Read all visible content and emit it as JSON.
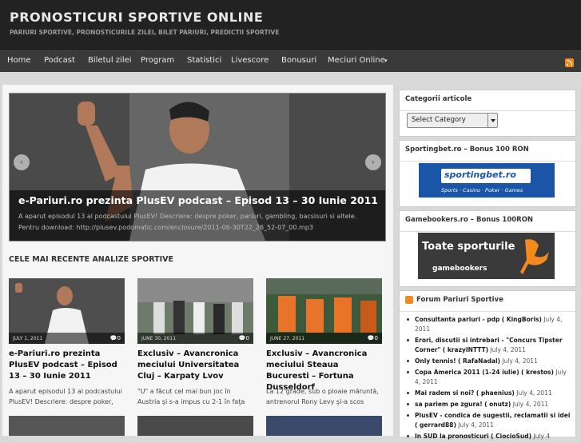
{
  "site": {
    "title": "PRONOSTICURI SPORTIVE ONLINE",
    "description": "PARIURI SPORTIVE, PRONOSTICURILE ZILEI, BILET PARIURI, PREDICTII SPORTIVE"
  },
  "nav": {
    "items": [
      "Home",
      "Podcast",
      "Biletul zilei",
      "Program",
      "Statistici",
      "Livescore",
      "Bonusuri",
      "Meciuri Online"
    ],
    "dropdown_icon": "caret-down-icon",
    "rss_icon": "rss-icon"
  },
  "slider": {
    "title": "e-Pariuri.ro prezinta PlusEV podcast – Episod 13 – 30 Iunie 2011",
    "excerpt": "A aparut episodul 13 al podcastului PlusEV! Descriere: despre poker, pariuri, gambling, bacsisuri si altele. Pentru download: http://plusev.podomatic.com/enclosure/2011-06-30T22_26_52-07_00.mp3",
    "prev_icon": "chevron-left-icon",
    "next_icon": "chevron-right-icon"
  },
  "recent": {
    "heading": "CELE MAI RECENTE ANALIZE SPORTIVE",
    "posts": [
      {
        "date": "JULY 1, 2011",
        "comments": "0",
        "title": "e-Pariuri.ro prezinta PlusEV podcast – Episod 13 – 30 Iunie 2011",
        "excerpt": "A aparut episodul 13 al podcastului PlusEV! Descriere: despre poker,"
      },
      {
        "date": "JUNE 30, 2011",
        "comments": "0",
        "title": "Exclusiv – Avancronica meciului Universitatea Cluj – Karpaty Lvov",
        "excerpt": "\"U\" a făcut cel mai bun joc în Austria şi s-a impus cu 2-1 în faţa"
      },
      {
        "date": "JUNE 27, 2011",
        "comments": "0",
        "title": "Exclusiv – Avancronica meciului Steaua Bucuresti – Fortuna Dusseldorf",
        "excerpt": "La 12 grade, sub o ploaie măruntă, antrenorul Rony Levy şi-a scos"
      }
    ]
  },
  "sidebar": {
    "categories": {
      "title": "Categorii articole",
      "select_value": "Select Category"
    },
    "sportingbet": {
      "title": "Sportingbet.ro – Bonus 100 RON",
      "banner_brand": "sportingbet.ro",
      "banner_tagline": "Sports · Casino · Poker · Games"
    },
    "gamebookers": {
      "title": "Gamebookers.ro – Bonus 100RON",
      "banner_text": "Toate sporturile",
      "banner_brand": "gamebookers"
    },
    "forum": {
      "title": "Forum Pariuri Sportive",
      "items": [
        {
          "link": "Consultanta pariuri - pdp",
          "author": "( KingBoris)",
          "date": "July 4, 2011"
        },
        {
          "link": "Erori, discutii si intrebari - \"Concurs Tipster Corner\"",
          "author": "( krazyINTTT)",
          "date": "July 4, 2011"
        },
        {
          "link": "Only tennis!",
          "author": "( RafaNadal)",
          "date": "July 4, 2011"
        },
        {
          "link": "Copa America 2011 (1-24 iulie)",
          "author": "( krestos)",
          "date": "July 4, 2011"
        },
        {
          "link": "Mai radem si noi?",
          "author": "( phaenius)",
          "date": "July 4, 2011"
        },
        {
          "link": "sa pariem pe zgura!",
          "author": "( onutz)",
          "date": "July 4, 2011"
        },
        {
          "link": "PlusEV - condica de sugestii, reclamatii si idei",
          "author": "( gerrard88)",
          "date": "July 4, 2011"
        },
        {
          "link": "In SUD la pronosticuri",
          "author": "( CiocioSud)",
          "date": "July 4"
        }
      ]
    }
  }
}
